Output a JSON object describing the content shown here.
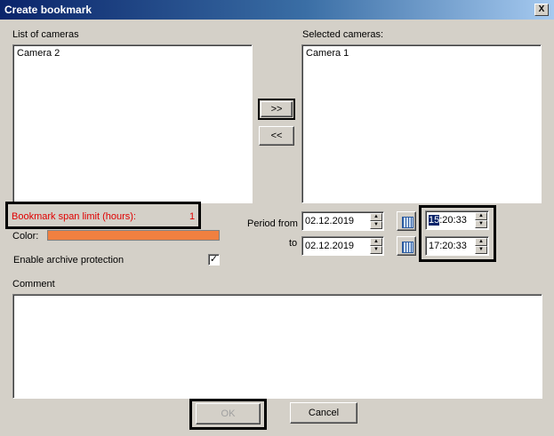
{
  "window": {
    "title": "Create bookmark",
    "close_glyph": "X"
  },
  "cameras": {
    "list_label": "List of cameras",
    "list_items": [
      "Camera 2"
    ],
    "selected_label": "Selected cameras:",
    "selected_items": [
      "Camera 1"
    ],
    "add_button": ">>",
    "remove_button": "<<"
  },
  "span_limit": {
    "label": "Bookmark span limit (hours):",
    "value": "1",
    "color": "#e00000"
  },
  "color": {
    "label": "Color:",
    "swatch": "#f08040"
  },
  "archive_protection": {
    "label": "Enable archive protection",
    "checked": true,
    "check_glyph": "✓"
  },
  "period": {
    "from_label": "Period from",
    "to_label": "to",
    "from_date": "02.12.2019",
    "to_date": "02.12.2019",
    "from_time_hour": "15",
    "from_time_rest": ":20:33",
    "to_time": "17:20:33"
  },
  "comment": {
    "label": "Comment",
    "value": ""
  },
  "buttons": {
    "ok": "OK",
    "cancel": "Cancel"
  },
  "icons": {
    "calendar": "calendar-icon",
    "spin_up": "▲",
    "spin_down": "▼"
  }
}
